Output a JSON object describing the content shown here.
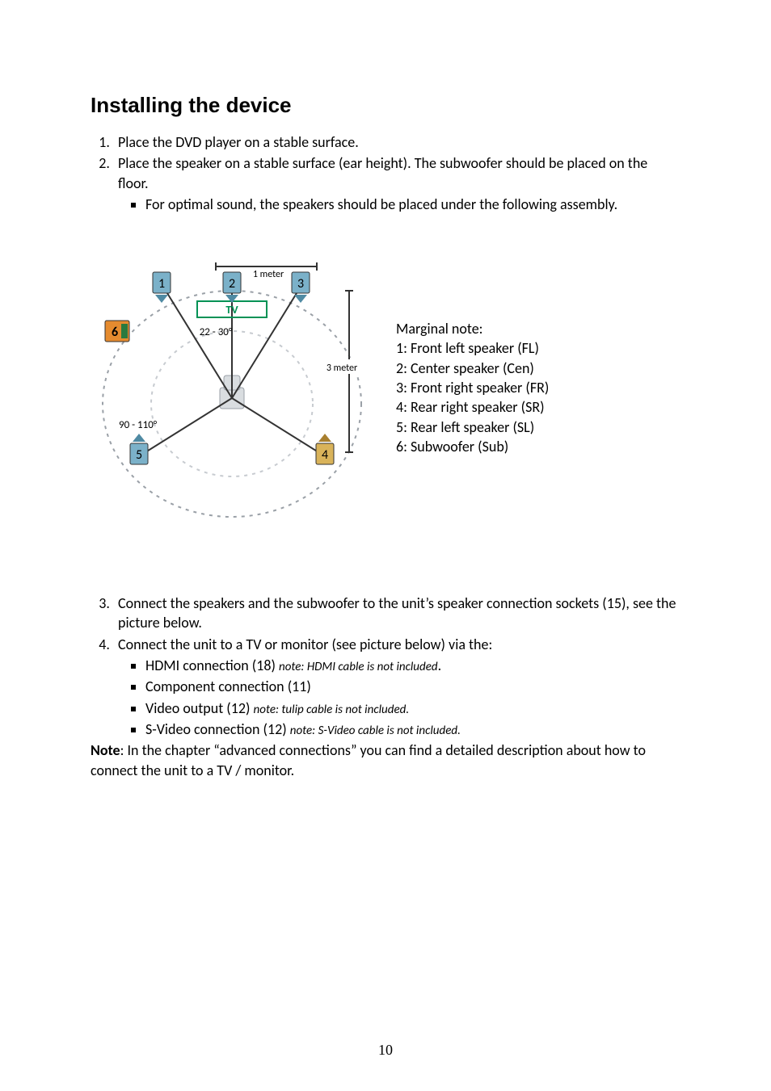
{
  "title": "Installing the device",
  "list": {
    "i1": "Place the DVD player on a stable surface.",
    "i2": "Place the speaker on a stable surface (ear height). The subwoofer should be placed on the floor.",
    "i2b1": "For optimal sound, the speakers should be placed under the following assembly.",
    "i3": "Connect the speakers and the subwoofer to the unit’s speaker connection sockets (15), see the picture below.",
    "i4": "Connect the unit to a TV or monitor (see picture below) via the:",
    "i4b1a": "HDMI connection (18) ",
    "i4b1b": "note: HDMI cable is not included",
    "i4b1c": ".",
    "i4b2": "Component connection (11)",
    "i4b3a": "Video output (12) ",
    "i4b3b": "note: tulip cable is not included.",
    "i4b4a": "S-Video connection (12) ",
    "i4b4b": "note: S-Video cable is not included."
  },
  "note_bold": "Note",
  "note_rest": ": In the chapter “advanced connections” you can find a detailed description about how to connect the unit to a TV / monitor.",
  "legend": {
    "h": "Marginal note:",
    "l1": "1: Front left speaker (FL)",
    "l2": "2: Center speaker (Cen)",
    "l3": "3: Front right speaker (FR)",
    "l4": "4: Rear right speaker (SR)",
    "l5": "5: Rear left speaker (SL)",
    "l6": "6: Subwoofer (Sub)"
  },
  "diagram": {
    "meter1": "1 meter",
    "meter3": "3 meter",
    "tv": "TV",
    "angle1": "22 - 30°",
    "angle2": "90 - 110°",
    "n1": "1",
    "n2": "2",
    "n3": "3",
    "n4": "4",
    "n5": "5",
    "n6": "6"
  },
  "pagenum": "10"
}
